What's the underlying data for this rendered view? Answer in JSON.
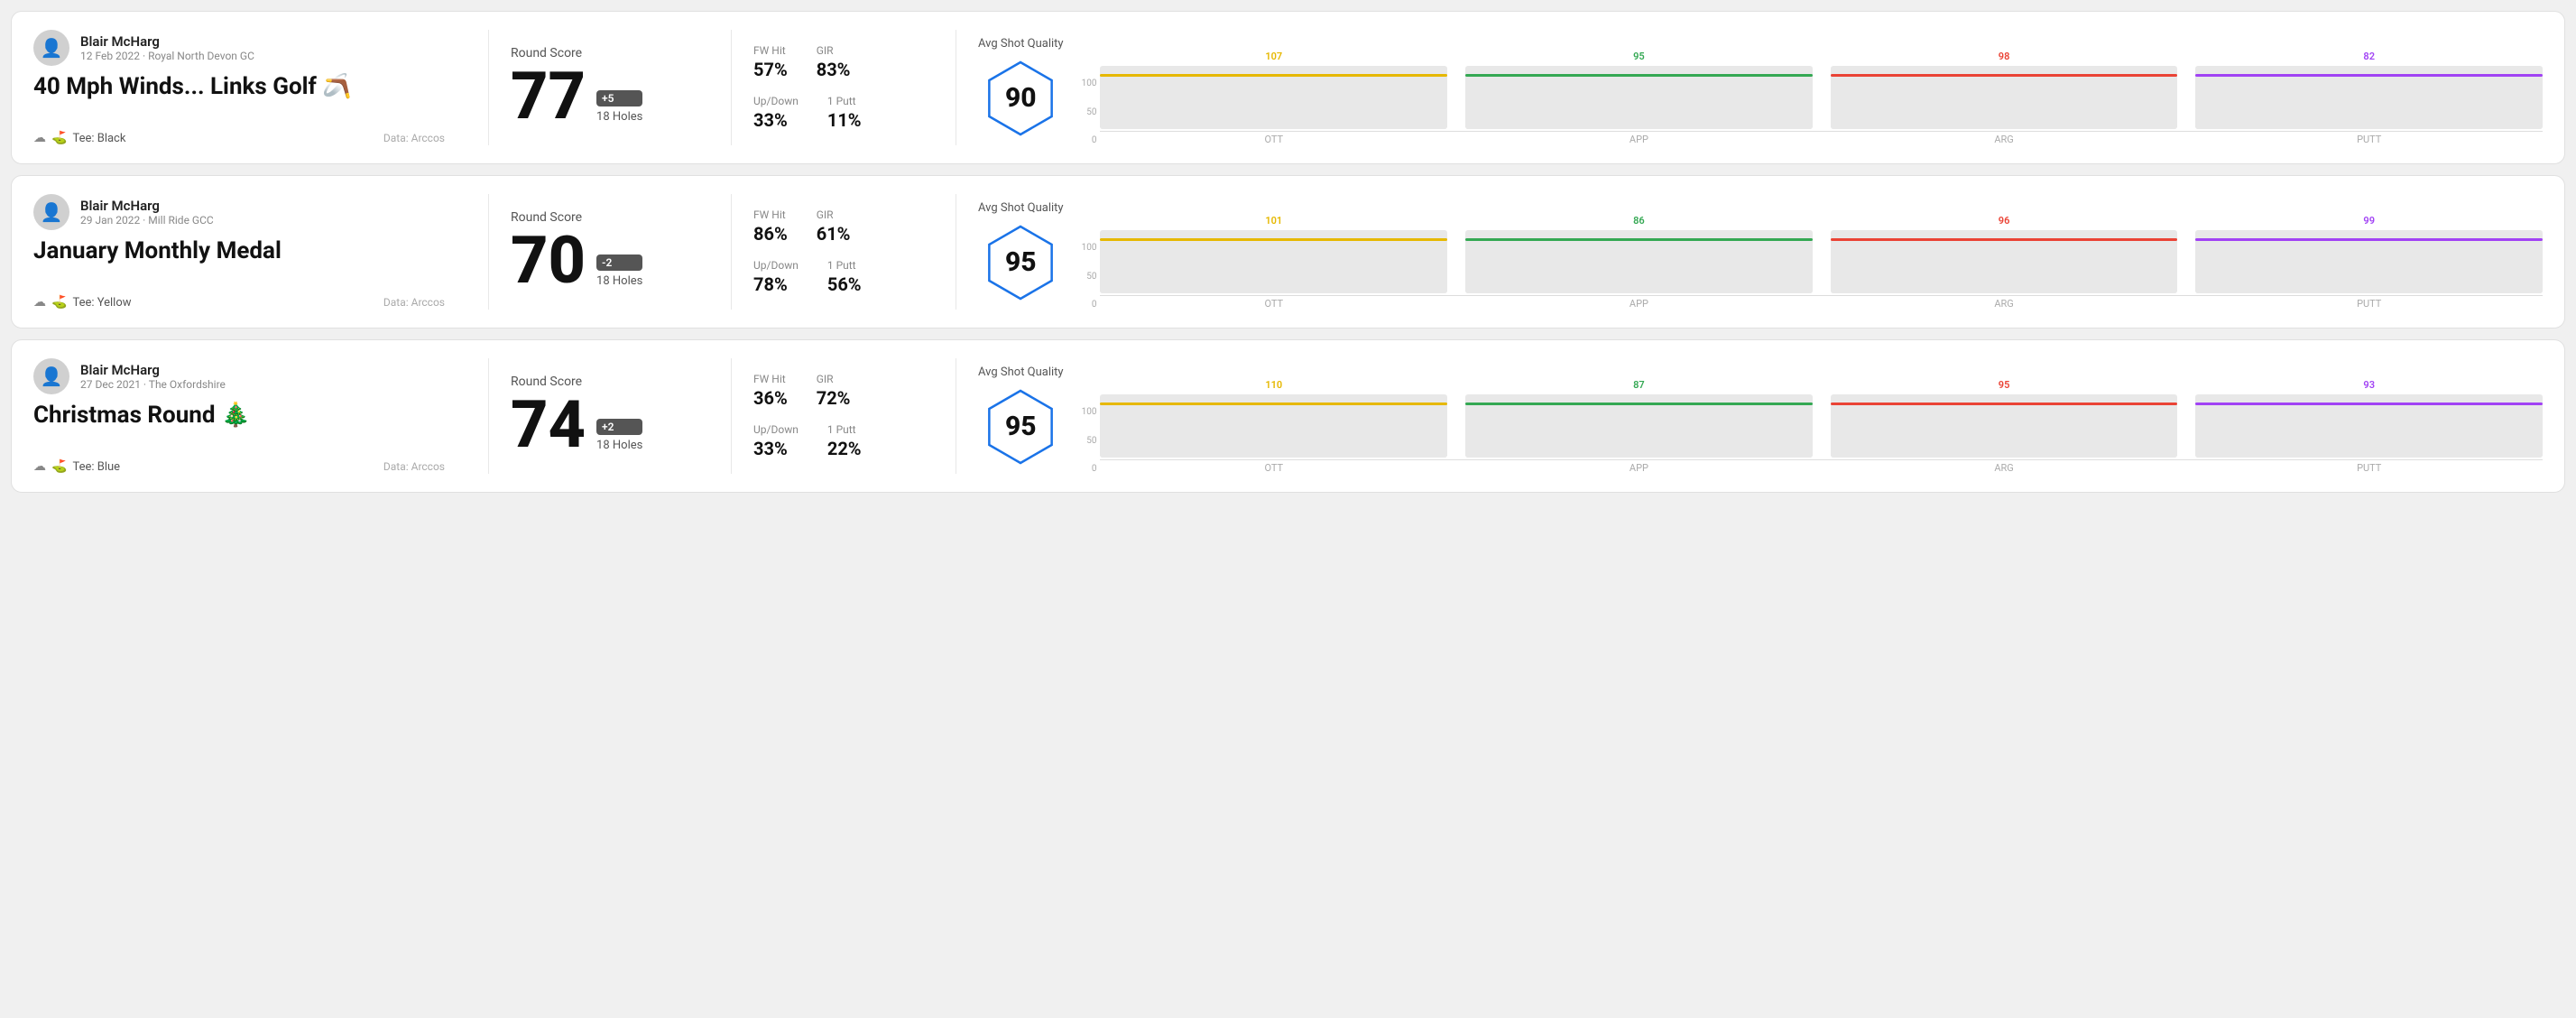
{
  "rounds": [
    {
      "id": "round-1",
      "player": {
        "name": "Blair McHarg",
        "date": "12 Feb 2022",
        "course": "Royal North Devon GC"
      },
      "title": "40 Mph Winds... Links Golf 🪃",
      "tee": "Black",
      "dataSource": "Data: Arccos",
      "score": {
        "label": "Round Score",
        "value": "77",
        "badge": "+5",
        "holes": "18 Holes"
      },
      "stats": {
        "fwHit": {
          "label": "FW Hit",
          "value": "57%"
        },
        "gir": {
          "label": "GIR",
          "value": "83%"
        },
        "upDown": {
          "label": "Up/Down",
          "value": "33%"
        },
        "putt1": {
          "label": "1 Putt",
          "value": "11%"
        }
      },
      "quality": {
        "label": "Avg Shot Quality",
        "score": "90",
        "hexColor": "#1a73e8",
        "bars": [
          {
            "category": "OTT",
            "value": 107,
            "color": "#e6b800",
            "maxValue": 120
          },
          {
            "category": "APP",
            "value": 95,
            "color": "#34a853",
            "maxValue": 120
          },
          {
            "category": "ARG",
            "value": 98,
            "color": "#ea4335",
            "maxValue": 120
          },
          {
            "category": "PUTT",
            "value": 82,
            "color": "#a142f4",
            "maxValue": 120
          }
        ]
      }
    },
    {
      "id": "round-2",
      "player": {
        "name": "Blair McHarg",
        "date": "29 Jan 2022",
        "course": "Mill Ride GCC"
      },
      "title": "January Monthly Medal",
      "tee": "Yellow",
      "dataSource": "Data: Arccos",
      "score": {
        "label": "Round Score",
        "value": "70",
        "badge": "-2",
        "holes": "18 Holes"
      },
      "stats": {
        "fwHit": {
          "label": "FW Hit",
          "value": "86%"
        },
        "gir": {
          "label": "GIR",
          "value": "61%"
        },
        "upDown": {
          "label": "Up/Down",
          "value": "78%"
        },
        "putt1": {
          "label": "1 Putt",
          "value": "56%"
        }
      },
      "quality": {
        "label": "Avg Shot Quality",
        "score": "95",
        "hexColor": "#1a73e8",
        "bars": [
          {
            "category": "OTT",
            "value": 101,
            "color": "#e6b800",
            "maxValue": 120
          },
          {
            "category": "APP",
            "value": 86,
            "color": "#34a853",
            "maxValue": 120
          },
          {
            "category": "ARG",
            "value": 96,
            "color": "#ea4335",
            "maxValue": 120
          },
          {
            "category": "PUTT",
            "value": 99,
            "color": "#a142f4",
            "maxValue": 120
          }
        ]
      }
    },
    {
      "id": "round-3",
      "player": {
        "name": "Blair McHarg",
        "date": "27 Dec 2021",
        "course": "The Oxfordshire"
      },
      "title": "Christmas Round 🎄",
      "tee": "Blue",
      "dataSource": "Data: Arccos",
      "score": {
        "label": "Round Score",
        "value": "74",
        "badge": "+2",
        "holes": "18 Holes"
      },
      "stats": {
        "fwHit": {
          "label": "FW Hit",
          "value": "36%"
        },
        "gir": {
          "label": "GIR",
          "value": "72%"
        },
        "upDown": {
          "label": "Up/Down",
          "value": "33%"
        },
        "putt1": {
          "label": "1 Putt",
          "value": "22%"
        }
      },
      "quality": {
        "label": "Avg Shot Quality",
        "score": "95",
        "hexColor": "#1a73e8",
        "bars": [
          {
            "category": "OTT",
            "value": 110,
            "color": "#e6b800",
            "maxValue": 120
          },
          {
            "category": "APP",
            "value": 87,
            "color": "#34a853",
            "maxValue": 120
          },
          {
            "category": "ARG",
            "value": 95,
            "color": "#ea4335",
            "maxValue": 120
          },
          {
            "category": "PUTT",
            "value": 93,
            "color": "#a142f4",
            "maxValue": 120
          }
        ]
      }
    }
  ],
  "chartYLabels": [
    "100",
    "50",
    "0"
  ],
  "icons": {
    "avatar": "👤",
    "weather": "☁",
    "tee": "⛳"
  }
}
